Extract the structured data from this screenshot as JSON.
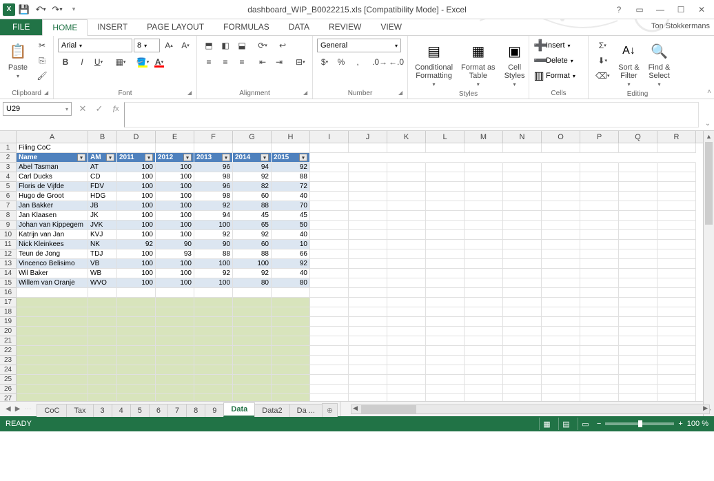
{
  "title": "dashboard_WIP_B0022215.xls  [Compatibility Mode] - Excel",
  "user": "Ton Stokkermans",
  "qat": {
    "save": "💾",
    "undo": "↶",
    "redo": "↷"
  },
  "tabs": {
    "file": "FILE",
    "home": "HOME",
    "insert": "INSERT",
    "page_layout": "PAGE LAYOUT",
    "formulas": "FORMULAS",
    "data": "DATA",
    "review": "REVIEW",
    "view": "VIEW"
  },
  "ribbon": {
    "clipboard": {
      "label": "Clipboard",
      "paste": "Paste"
    },
    "font": {
      "label": "Font",
      "name": "Arial",
      "size": "8"
    },
    "alignment": {
      "label": "Alignment"
    },
    "number": {
      "label": "Number",
      "format": "General"
    },
    "styles": {
      "label": "Styles",
      "cond": "Conditional\nFormatting",
      "table": "Format as\nTable",
      "cell": "Cell\nStyles"
    },
    "cells": {
      "label": "Cells",
      "insert": "Insert",
      "delete": "Delete",
      "format": "Format"
    },
    "editing": {
      "label": "Editing",
      "sort": "Sort &\nFilter",
      "find": "Find &\nSelect"
    }
  },
  "name_box": "U29",
  "columns": [
    "A",
    "B",
    "D",
    "E",
    "F",
    "G",
    "H",
    "I",
    "J",
    "K",
    "L",
    "M",
    "N",
    "O",
    "P",
    "Q",
    "R"
  ],
  "row_numbers": [
    "1",
    "2",
    "3",
    "4",
    "5",
    "6",
    "7",
    "8",
    "9",
    "10",
    "11",
    "12",
    "13",
    "14",
    "15",
    "16",
    "17",
    "18",
    "19",
    "20",
    "21",
    "22",
    "23",
    "24",
    "25",
    "26",
    "27"
  ],
  "title_cell": "Filing CoC",
  "headers": [
    "Name",
    "AM",
    "2011",
    "2012",
    "2013",
    "2014",
    "2015"
  ],
  "rows": [
    {
      "name": "Abel Tasman",
      "am": "AT",
      "y": [
        100,
        100,
        96,
        94,
        92
      ]
    },
    {
      "name": "Carl Ducks",
      "am": "CD",
      "y": [
        100,
        100,
        98,
        92,
        88
      ]
    },
    {
      "name": "Floris de Vijfde",
      "am": "FDV",
      "y": [
        100,
        100,
        96,
        82,
        72
      ]
    },
    {
      "name": "Hugo de Groot",
      "am": "HDG",
      "y": [
        100,
        100,
        98,
        60,
        40
      ]
    },
    {
      "name": "Jan Bakker",
      "am": "JB",
      "y": [
        100,
        100,
        92,
        88,
        70
      ]
    },
    {
      "name": "Jan Klaasen",
      "am": "JK",
      "y": [
        100,
        100,
        94,
        45,
        45
      ]
    },
    {
      "name": "Johan van Kippegem",
      "am": "JVK",
      "y": [
        100,
        100,
        100,
        65,
        50
      ]
    },
    {
      "name": "Katrijn van Jan",
      "am": "KVJ",
      "y": [
        100,
        100,
        92,
        92,
        40
      ]
    },
    {
      "name": "Nick Kleinkees",
      "am": "NK",
      "y": [
        92,
        90,
        90,
        60,
        10
      ]
    },
    {
      "name": "Teun de Jong",
      "am": "TDJ",
      "y": [
        100,
        93,
        88,
        88,
        66
      ]
    },
    {
      "name": "Vincenco Belisimo",
      "am": "VB",
      "y": [
        100,
        100,
        100,
        100,
        92
      ]
    },
    {
      "name": "Wil Baker",
      "am": "WB",
      "y": [
        100,
        100,
        92,
        92,
        40
      ]
    },
    {
      "name": "Willem van Oranje",
      "am": "WVO",
      "y": [
        100,
        100,
        100,
        80,
        80
      ]
    }
  ],
  "sheets": [
    "CoC",
    "Tax",
    "3",
    "4",
    "5",
    "6",
    "7",
    "8",
    "9",
    "Data",
    "Data2",
    "Da ..."
  ],
  "active_sheet": "Data",
  "status": "READY",
  "zoom": "100 %"
}
